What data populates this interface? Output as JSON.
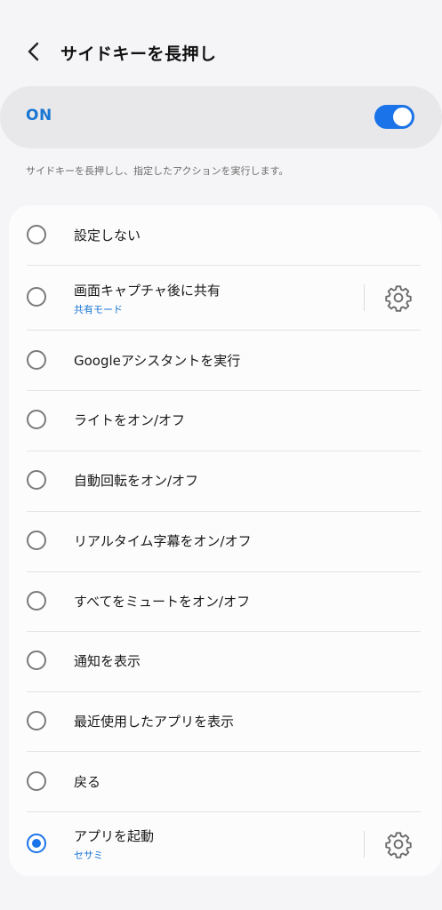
{
  "header": {
    "title": "サイドキーを長押し",
    "back_icon": "chevron-left-icon"
  },
  "master_switch": {
    "label": "ON",
    "state": true
  },
  "description": "サイドキーを長押しし、指定したアクションを実行します。",
  "options": [
    {
      "label": "設定しない",
      "sub": "",
      "selected": false,
      "has_settings": false
    },
    {
      "label": "画面キャプチャ後に共有",
      "sub": "共有モード",
      "selected": false,
      "has_settings": true
    },
    {
      "label": "Googleアシスタントを実行",
      "sub": "",
      "selected": false,
      "has_settings": false
    },
    {
      "label": "ライトをオン/オフ",
      "sub": "",
      "selected": false,
      "has_settings": false
    },
    {
      "label": "自動回転をオン/オフ",
      "sub": "",
      "selected": false,
      "has_settings": false
    },
    {
      "label": "リアルタイム字幕をオン/オフ",
      "sub": "",
      "selected": false,
      "has_settings": false
    },
    {
      "label": "すべてをミュートをオン/オフ",
      "sub": "",
      "selected": false,
      "has_settings": false
    },
    {
      "label": "通知を表示",
      "sub": "",
      "selected": false,
      "has_settings": false
    },
    {
      "label": "最近使用したアプリを表示",
      "sub": "",
      "selected": false,
      "has_settings": false
    },
    {
      "label": "戻る",
      "sub": "",
      "selected": false,
      "has_settings": false
    },
    {
      "label": "アプリを起動",
      "sub": "セサミ",
      "selected": true,
      "has_settings": true
    }
  ],
  "colors": {
    "accent": "#1a73e8",
    "sub_text": "#1976d2"
  }
}
